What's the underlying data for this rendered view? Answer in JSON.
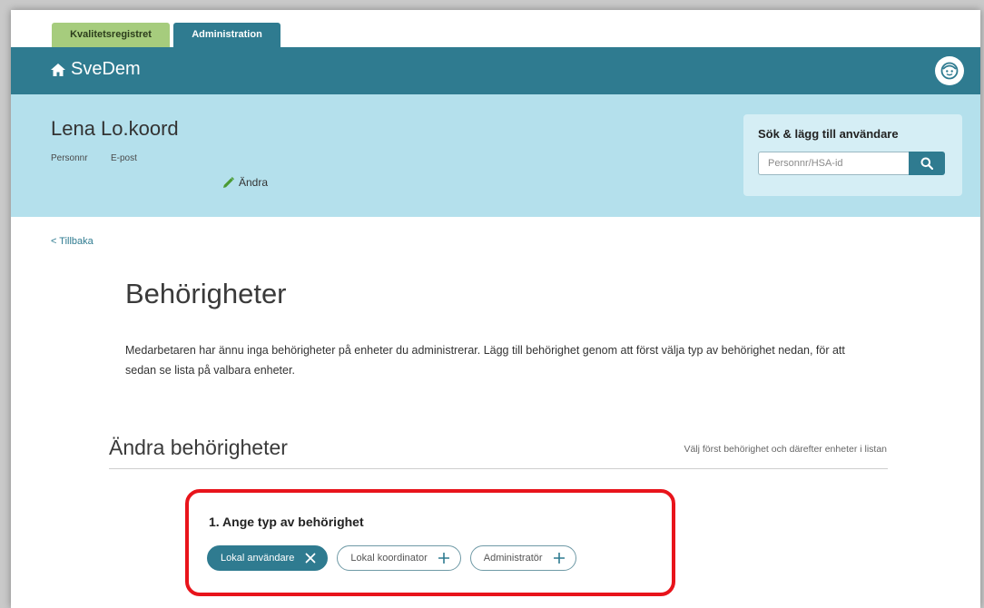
{
  "tabs": [
    {
      "label": "Kvalitetsregistret"
    },
    {
      "label": "Administration"
    }
  ],
  "brand": {
    "name": "SveDem"
  },
  "profile": {
    "name": "Lena Lo.koord",
    "personnr_label": "Personnr",
    "epost_label": "E-post",
    "edit_label": "Ändra"
  },
  "search": {
    "title": "Sök & lägg till användare",
    "placeholder": "Personnr/HSA-id"
  },
  "nav": {
    "back_label": "< Tillbaka"
  },
  "main": {
    "title": "Behörigheter",
    "intro": "Medarbetaren har ännu inga behörigheter på enheter du administrerar. Lägg till behörighet genom att först välja typ av behörighet nedan, för att sedan se lista på valbara enheter.",
    "section_title": "Ändra behörigheter",
    "section_hint": "Välj först behörighet och därefter enheter i listan",
    "step_title": "1. Ange typ av behörighet",
    "roles": [
      {
        "label": "Lokal användare",
        "selected": true
      },
      {
        "label": "Lokal koordinator",
        "selected": false
      },
      {
        "label": "Administratör",
        "selected": false
      }
    ]
  },
  "colors": {
    "primary": "#2f7b90",
    "header_bg": "#b4e0ec",
    "tab_green": "#a6cc7d",
    "highlight_red": "#e8141b"
  }
}
